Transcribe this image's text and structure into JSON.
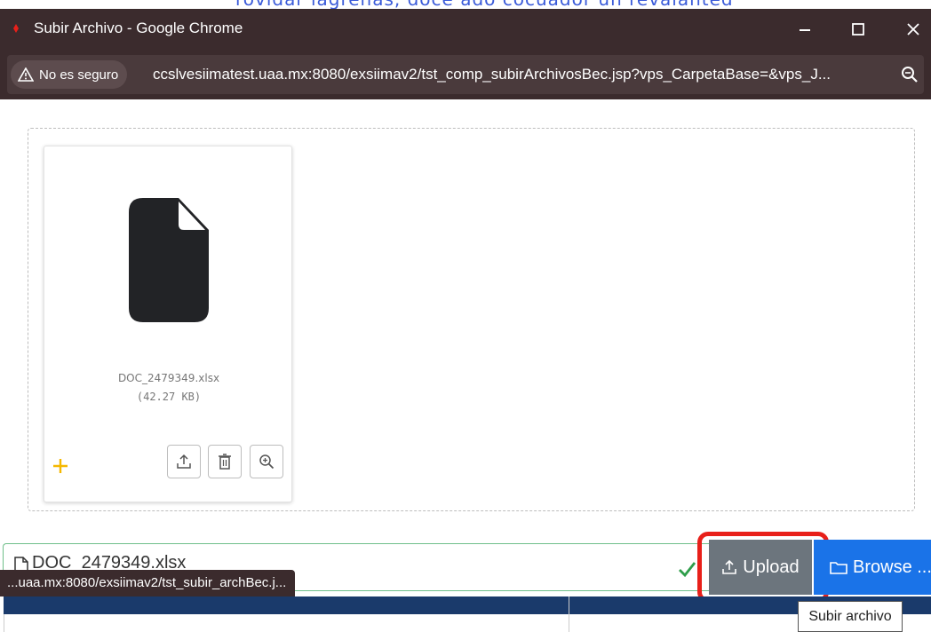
{
  "top_fragment": "rovidar lagrenas, doce ado cocuador un revalanted",
  "window": {
    "title": "Subir Archivo - Google Chrome",
    "minimize_icon": "minimize-icon",
    "maximize_icon": "maximize-icon",
    "close_icon": "close-icon"
  },
  "address_bar": {
    "security_label": "No es seguro",
    "url": "ccslvesiimatest.uaa.mx:8080/exsiimav2/tst_comp_subirArchivosBec.jsp?vps_CarpetaBase=&vps_J..."
  },
  "file_card": {
    "file_name": "DOC_2479349.xlsx",
    "file_size": "(42.27 KB)"
  },
  "caption": {
    "text": "DOC_2479349.xlsx"
  },
  "buttons": {
    "upload_label": "Upload",
    "browse_label": "Browse ..."
  },
  "status_bar": {
    "text": "...uaa.mx:8080/exsiimav2/tst_subir_archBec.j..."
  },
  "tooltip": {
    "text": "Subir archivo"
  },
  "colors": {
    "chrome_frame": "#3b2b2d",
    "upload_button": "#6c757d",
    "browse_button": "#1a73e8",
    "highlight": "#e8201a",
    "success_check": "#2e9e4a",
    "plus": "#f5b800"
  }
}
